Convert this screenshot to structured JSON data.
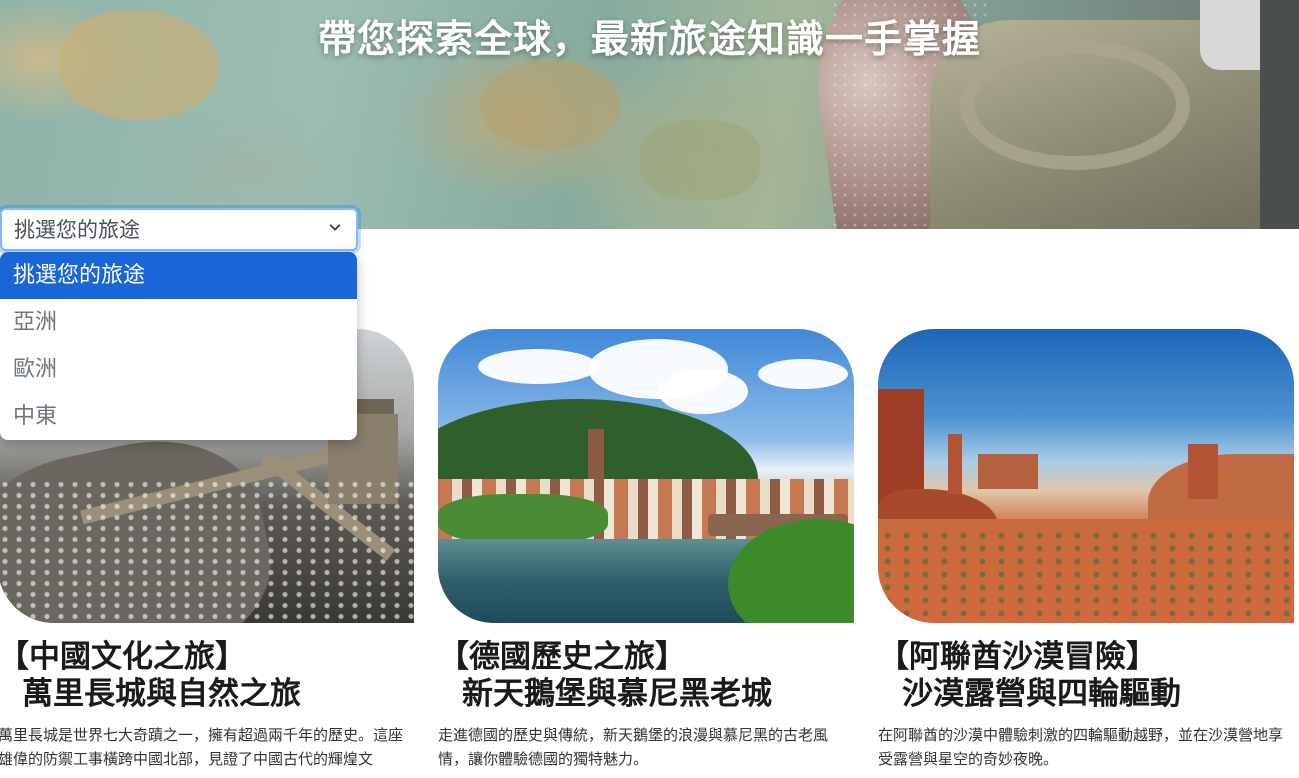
{
  "hero": {
    "title": "帶您探索全球，最新旅途知識一手掌握"
  },
  "trip_select": {
    "selected": "挑選您的旅途",
    "options": [
      "挑選您的旅途",
      "亞洲",
      "歐洲",
      "中東"
    ]
  },
  "cards": [
    {
      "title_line1": "【中國文化之旅】",
      "title_line2": "萬里長城與自然之旅",
      "desc": "萬里長城是世界七大奇蹟之一，擁有超過兩千年的歷史。這座雄偉的防禦工事橫跨中國北部，見證了中國古代的輝煌文",
      "image": "great-wall-photo"
    },
    {
      "title_line1": "【德國歷史之旅】",
      "title_line2": "新天鵝堡與慕尼黑老城",
      "desc": "走進德國的歷史與傳統，新天鵝堡的浪漫與慕尼黑的古老風情，讓你體驗德國的獨特魅力。",
      "image": "heidelberg-river-photo"
    },
    {
      "title_line1": "【阿聯酋沙漠冒險】",
      "title_line2": "沙漠露營與四輪驅動",
      "desc": "在阿聯酋的沙漠中體驗刺激的四輪驅動越野，並在沙漠營地享受露營與星空的奇妙夜晚。",
      "image": "desert-buttes-photo"
    }
  ],
  "colors": {
    "selected_option": "#1a66d6",
    "focus_border": "#86b7fe"
  }
}
